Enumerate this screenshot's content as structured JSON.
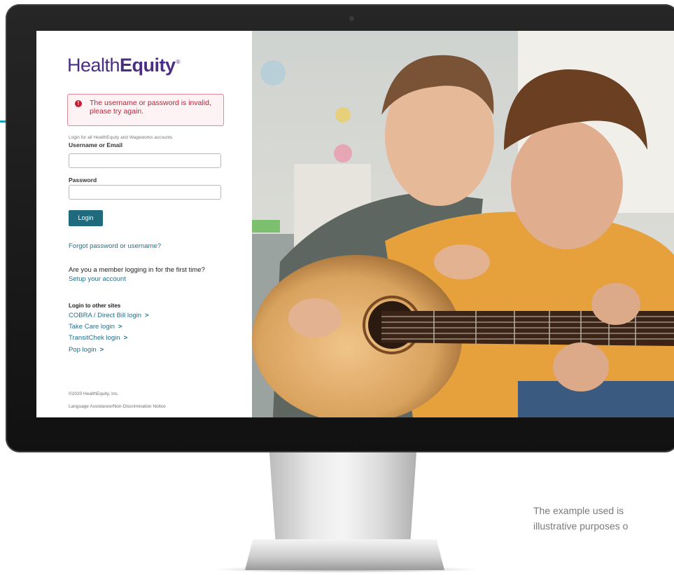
{
  "login": {
    "brand_regular": "Health",
    "brand_bold": "Equity",
    "brand_mark": "®",
    "error_message": "The username or password is invalid, please try again.",
    "accounts_note": "Login for all HealthEquity and Wageworks accounts",
    "username_label": "Username or Email",
    "username_value": "",
    "password_label": "Password",
    "password_value": "",
    "login_button": "Login",
    "forgot_link": "Forgot password or username?",
    "first_time_question": "Are you a member logging in for the first time?",
    "setup_link": "Setup your account",
    "other_sites_heading": "Login to other sites",
    "other_sites": [
      {
        "label": "COBRA / Direct Bill login"
      },
      {
        "label": "Take Care login"
      },
      {
        "label": "TransitChek login"
      },
      {
        "label": "Pop login"
      }
    ],
    "chevron": ">",
    "copyright": "©2020 HealthEquity, Inc.",
    "footer_notice": "Language Assistance/Non-Discrimination Notice"
  },
  "disclaimer": {
    "line1": "The example used is",
    "line2": "illustrative purposes o"
  },
  "colors": {
    "brand": "#4b2e83",
    "error": "#c21d33",
    "button": "#1f6b7d",
    "link": "#237089",
    "callout": "#1aa3bf"
  }
}
